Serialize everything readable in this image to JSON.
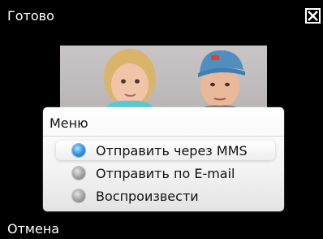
{
  "softkeys": {
    "top_left": "Готово",
    "bottom_left": "Отмена"
  },
  "close_icon": "close-x-icon",
  "photo": {
    "description_icon": "photo-thumbnail"
  },
  "menu": {
    "title": "Меню",
    "items": [
      {
        "label": "Отправить через MMS",
        "selected": true
      },
      {
        "label": "Отправить по E-mail",
        "selected": false
      },
      {
        "label": "Воспроизвести",
        "selected": false
      }
    ]
  },
  "colors": {
    "background": "#000000",
    "menu_bg": "#f3f3f3",
    "radio_selected": "#3f9ae6",
    "radio_unselected": "#9e9e9e"
  }
}
